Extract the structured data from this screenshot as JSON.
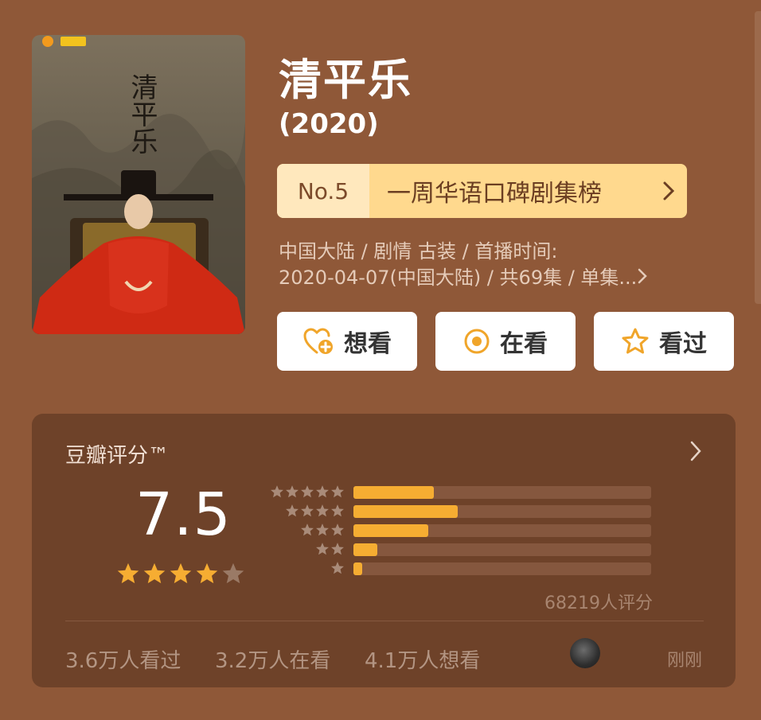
{
  "title": "清平乐",
  "year": "(2020)",
  "rank": {
    "no": "No.5",
    "label": "一周华语口碑剧集榜"
  },
  "meta": {
    "line1": "中国大陆 / 剧情 古装 / 首播时间:",
    "line2": "2020-04-07(中国大陆) / 共69集 / 单集..."
  },
  "actions": [
    {
      "label": "想看",
      "icon": "heart-plus-icon"
    },
    {
      "label": "在看",
      "icon": "radio-dot-icon"
    },
    {
      "label": "看过",
      "icon": "star-outline-icon"
    }
  ],
  "poster": {
    "title_text": "清平乐"
  },
  "rating": {
    "title": "豆瓣评分™",
    "score": "7.5",
    "stars_filled": 4,
    "stars_total": 5,
    "distribution": [
      {
        "stars": 5,
        "fraction": 0.27
      },
      {
        "stars": 4,
        "fraction": 0.35
      },
      {
        "stars": 3,
        "fraction": 0.25
      },
      {
        "stars": 2,
        "fraction": 0.08
      },
      {
        "stars": 1,
        "fraction": 0.03
      }
    ],
    "count": "68219人评分"
  },
  "stats": {
    "watched": "3.6万人看过",
    "watching": "3.2万人在看",
    "want": "4.1万人想看",
    "recent": "刚刚"
  },
  "colors": {
    "background": "#8f5838",
    "card": "#6e4229",
    "accent": "#f6ad32",
    "rank_bg": "#ffd98e"
  }
}
